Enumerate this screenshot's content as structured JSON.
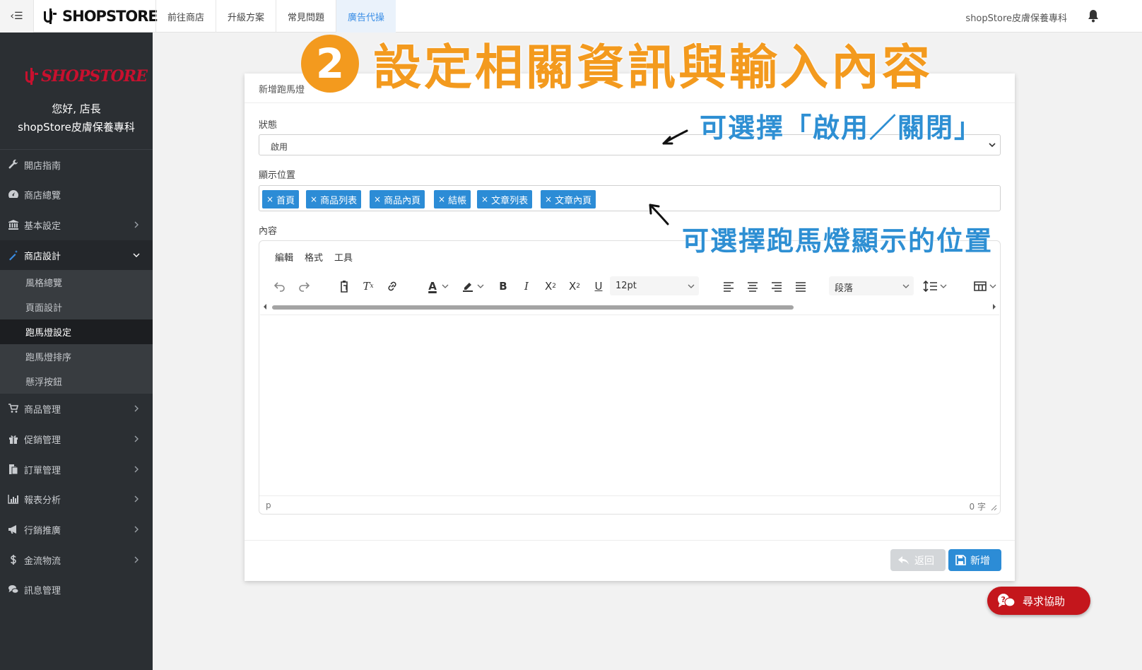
{
  "topbar": {
    "toggle_label": "‹☰",
    "brand": "SHOPSTORE",
    "nav": [
      {
        "label": "前往商店",
        "active": false
      },
      {
        "label": "升級方案",
        "active": false
      },
      {
        "label": "常見問題",
        "active": false
      },
      {
        "label": "廣告代操",
        "active": true
      }
    ],
    "store_name": "shopStore皮膚保養專科"
  },
  "sidebar": {
    "logo_text": "SHOPSTORE",
    "greeting": "您好, 店長",
    "store_name": "shopStore皮膚保養專科",
    "items": [
      {
        "label": "開店指南",
        "icon": "wrench-icon"
      },
      {
        "label": "商店總覽",
        "icon": "dashboard-icon"
      },
      {
        "label": "基本設定",
        "icon": "bank-icon"
      },
      {
        "label": "商店設計",
        "icon": "magic-wand-icon"
      },
      {
        "label": "商品管理",
        "icon": "cart-icon"
      },
      {
        "label": "促銷管理",
        "icon": "gift-icon"
      },
      {
        "label": "訂單管理",
        "icon": "copy-icon"
      },
      {
        "label": "報表分析",
        "icon": "bar-chart-icon"
      },
      {
        "label": "行銷推廣",
        "icon": "bullhorn-icon"
      },
      {
        "label": "金流物流",
        "icon": "dollar-icon"
      },
      {
        "label": "訊息管理",
        "icon": "comments-icon"
      }
    ],
    "submenu": [
      {
        "label": "風格總覽",
        "active": false
      },
      {
        "label": "頁面設計",
        "active": false
      },
      {
        "label": "跑馬燈設定",
        "active": true
      },
      {
        "label": "跑馬燈排序",
        "active": false
      },
      {
        "label": "懸浮按鈕",
        "active": false
      }
    ]
  },
  "form": {
    "card_title": "新增跑馬燈",
    "status_label": "狀態",
    "status_value": "啟用",
    "position_label": "顯示位置",
    "positions": [
      "首頁",
      "商品列表",
      "商品內頁",
      "結帳",
      "文章列表",
      "文章內頁"
    ],
    "content_label": "內容",
    "editor": {
      "menus": [
        "編輯",
        "格式",
        "工具"
      ],
      "font_size": "12pt",
      "block_format": "段落",
      "path": "p",
      "word_count": "0 字"
    },
    "back_label": "返回",
    "add_label": "新增"
  },
  "annotations": {
    "step_number": "2",
    "title": "設定相關資訊與輸入內容",
    "note_status": "可選擇「啟用／關閉」",
    "note_position": "可選擇跑馬燈顯示的位置"
  },
  "help_label": "尋求協助",
  "colors": {
    "accent": "#2c8cd6",
    "sidebar_bg": "#2b2f33",
    "annotation_orange": "#f39a1e",
    "annotation_blue": "#2e8fd3",
    "help_red": "#c4161c"
  }
}
